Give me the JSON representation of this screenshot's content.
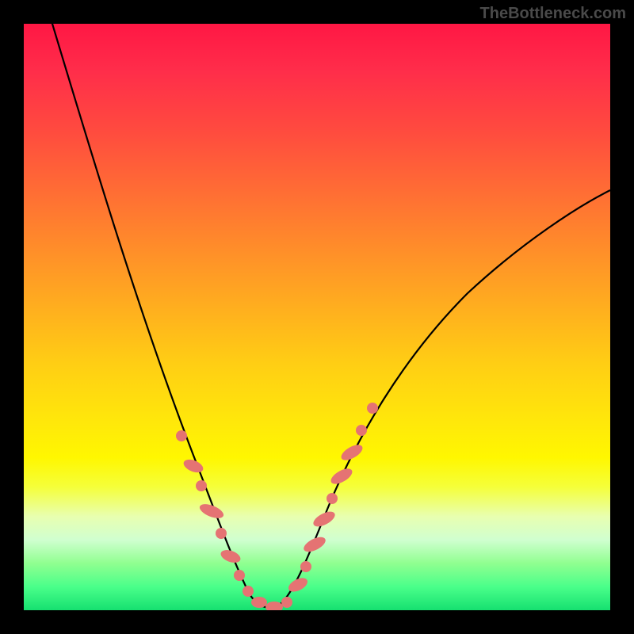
{
  "watermark": "TheBottleneck.com",
  "chart_data": {
    "type": "line",
    "title": "",
    "xlabel": "",
    "ylabel": "",
    "xlim": [
      0,
      100
    ],
    "ylim": [
      0,
      100
    ],
    "series": [
      {
        "name": "bottleneck-curve",
        "x": [
          4,
          10,
          15,
          20,
          24,
          28,
          32,
          34,
          36,
          38,
          40,
          42,
          44,
          46,
          50,
          56,
          62,
          70,
          80,
          92,
          100
        ],
        "y": [
          100,
          78,
          62,
          46,
          34,
          22,
          12,
          8,
          4,
          2,
          0,
          2,
          6,
          12,
          22,
          34,
          44,
          54,
          62,
          68,
          70
        ]
      }
    ],
    "highlighted_points": {
      "name": "fit-markers",
      "x": [
        26,
        27,
        29,
        30,
        31,
        32,
        33,
        34,
        36,
        38,
        40,
        42,
        44,
        45,
        46,
        47,
        48,
        49,
        50,
        51,
        53,
        55
      ],
      "y": [
        28,
        25,
        20,
        17,
        14,
        11,
        9,
        6,
        2,
        0,
        0,
        1,
        5,
        8,
        11,
        14,
        17,
        20,
        23,
        26,
        30,
        34
      ]
    },
    "background": {
      "type": "vertical-gradient",
      "stops": [
        {
          "pos": 0,
          "color": "#ff1744"
        },
        {
          "pos": 50,
          "color": "#ffce14"
        },
        {
          "pos": 78,
          "color": "#fff700"
        },
        {
          "pos": 100,
          "color": "#16e070"
        }
      ]
    }
  }
}
